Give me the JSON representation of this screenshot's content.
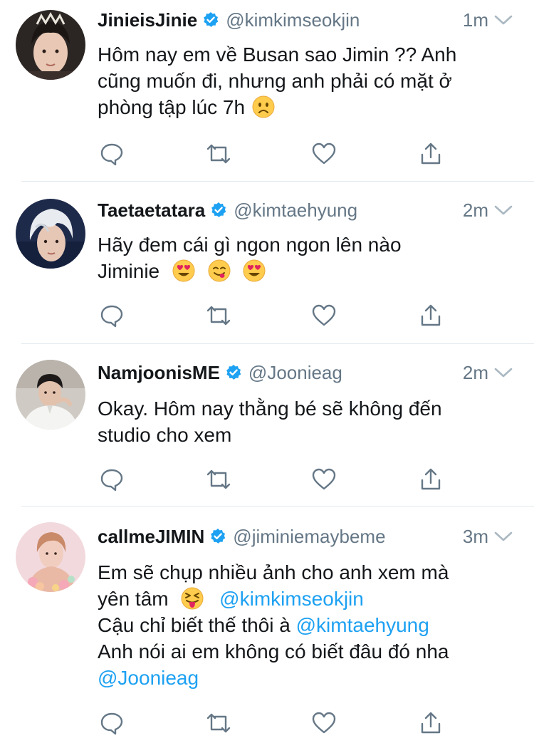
{
  "colors": {
    "text": "#14171a",
    "secondary": "#657786",
    "mention": "#1da1f2",
    "verified": "#1da1f2",
    "divider": "#e1e8ed"
  },
  "tweets": [
    {
      "name": "JinieisJinie",
      "handle": "@kimkimseokjin",
      "time": "1m",
      "lines": [
        "Hôm nay em về Busan sao Jimin ?? Anh",
        "cũng muốn đi, nhưng anh phải có mặt ở",
        "phòng tập lúc 7h"
      ],
      "emoji": [
        "frowning-face"
      ]
    },
    {
      "name": "Taetaetatara",
      "handle": "@kimtaehyung",
      "time": "2m",
      "lines": [
        "Hãy đem cái gì ngon ngon lên nào",
        "Jiminie"
      ],
      "emoji": [
        "heart-eyes-face",
        "yum-face",
        "heart-eyes-face"
      ]
    },
    {
      "name": "NamjoonisME",
      "handle": "@Joonieag",
      "time": "2m",
      "lines": [
        "Okay. Hôm nay thằng bé sẽ không đến",
        "studio cho xem"
      ]
    },
    {
      "name": "callmeJIMIN",
      "handle": "@jiminiemaybeme",
      "time": "3m",
      "line1": "Em sẽ chụp nhiều ảnh cho anh xem mà",
      "line2_text": "yên tâm",
      "line2_emoji": "squinting-tongue-face",
      "line2_mention": "@kimkimseokjin",
      "line3_text": "Cậu chỉ biết thế thôi à",
      "line3_mention": "@kimtaehyung",
      "line4": "Anh nói ai em không có biết đâu đó nha",
      "line5_mention": "@Joonieag"
    }
  ]
}
